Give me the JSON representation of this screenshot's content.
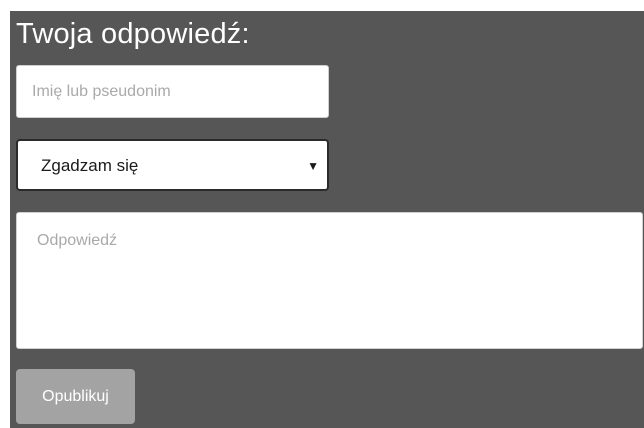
{
  "form": {
    "heading": "Twoja odpowiedź:",
    "name_placeholder": "Imię lub pseudonim",
    "name_value": "",
    "stance_select": {
      "selected": "Zgadzam się",
      "caret_icon": "caret-down-icon"
    },
    "answer_placeholder": "Odpowiedź",
    "answer_value": "",
    "submit_label": "Opublikuj"
  },
  "colors": {
    "panel_background": "#565656",
    "button_background": "#a3a3a3",
    "text_on_dark": "#ffffff",
    "placeholder_text": "#a9a9a9"
  }
}
